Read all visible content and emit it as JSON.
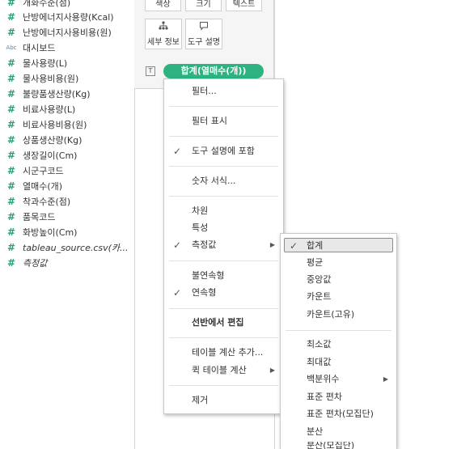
{
  "fields": [
    {
      "icon": "#",
      "label": "개화수준(점)",
      "type": "measure"
    },
    {
      "icon": "#",
      "label": "난방에너지사용량(Kcal)",
      "type": "measure"
    },
    {
      "icon": "#",
      "label": "난방에너지사용비용(원)",
      "type": "measure"
    },
    {
      "icon": "Abc",
      "label": "대시보드",
      "type": "dimension"
    },
    {
      "icon": "#",
      "label": "물사용량(L)",
      "type": "measure"
    },
    {
      "icon": "#",
      "label": "물사용비용(원)",
      "type": "measure"
    },
    {
      "icon": "#",
      "label": "불량품생산량(Kg)",
      "type": "measure"
    },
    {
      "icon": "#",
      "label": "비료사용량(L)",
      "type": "measure"
    },
    {
      "icon": "#",
      "label": "비료사용비용(원)",
      "type": "measure"
    },
    {
      "icon": "#",
      "label": "상품생산량(Kg)",
      "type": "measure"
    },
    {
      "icon": "#",
      "label": "생장길이(Cm)",
      "type": "measure"
    },
    {
      "icon": "#",
      "label": "시군구코드",
      "type": "measure"
    },
    {
      "icon": "#",
      "label": "열매수(개)",
      "type": "measure"
    },
    {
      "icon": "#",
      "label": "착과수준(점)",
      "type": "measure"
    },
    {
      "icon": "#",
      "label": "품목코드",
      "type": "measure"
    },
    {
      "icon": "#",
      "label": "화방높이(Cm)",
      "type": "measure"
    },
    {
      "icon": "#",
      "label": "tableau_source.csv(카...",
      "type": "measure",
      "italic": true
    },
    {
      "icon": "#",
      "label": "측정값",
      "type": "measure",
      "italic": true
    }
  ],
  "marks": {
    "top_buttons": [
      "색상",
      "크기",
      "텍스트"
    ],
    "detail_label": "세부 정보",
    "tooltip_label": "도구 설명",
    "text_icon": "T",
    "pill_label": "합계(열매수(개))"
  },
  "context_menu": {
    "items": [
      {
        "label": "필터...",
        "checked": false,
        "submenu": false,
        "bold": false
      },
      {
        "label": "필터 표시",
        "checked": false,
        "submenu": false,
        "bold": false
      },
      {
        "label": "도구 설명에 포함",
        "checked": true,
        "submenu": false,
        "bold": false
      },
      {
        "label": "숫자 서식...",
        "checked": false,
        "submenu": false,
        "bold": false
      },
      {
        "label": "차원",
        "checked": false,
        "submenu": false,
        "bold": false
      },
      {
        "label": "특성",
        "checked": false,
        "submenu": false,
        "bold": false
      },
      {
        "label": "측정값",
        "checked": true,
        "submenu": true,
        "bold": false
      },
      {
        "label": "불연속형",
        "checked": false,
        "submenu": false,
        "bold": false
      },
      {
        "label": "연속형",
        "checked": true,
        "submenu": false,
        "bold": false
      },
      {
        "label": "선반에서 편집",
        "checked": false,
        "submenu": false,
        "bold": true
      },
      {
        "label": "테이블 계산 추가...",
        "checked": false,
        "submenu": false,
        "bold": false
      },
      {
        "label": "퀵 테이블 계산",
        "checked": false,
        "submenu": true,
        "bold": false
      },
      {
        "label": "제거",
        "checked": false,
        "submenu": false,
        "bold": false
      }
    ]
  },
  "measure_submenu": {
    "items": [
      {
        "label": "합계",
        "checked": true,
        "selected": true,
        "submenu": false
      },
      {
        "label": "평균",
        "checked": false,
        "submenu": false
      },
      {
        "label": "중앙값",
        "checked": false,
        "submenu": false
      },
      {
        "label": "카운트",
        "checked": false,
        "submenu": false
      },
      {
        "label": "카운트(고유)",
        "checked": false,
        "submenu": false
      },
      {
        "label": "최소값",
        "checked": false,
        "submenu": false
      },
      {
        "label": "최대값",
        "checked": false,
        "submenu": false
      },
      {
        "label": "백분위수",
        "checked": false,
        "submenu": true
      },
      {
        "label": "표준 편차",
        "checked": false,
        "submenu": false
      },
      {
        "label": "표준 편차(모집단)",
        "checked": false,
        "submenu": false
      },
      {
        "label": "분산",
        "checked": false,
        "submenu": false
      },
      {
        "label": "분산(모집단)",
        "checked": false,
        "submenu": false
      }
    ]
  },
  "symbols": {
    "check": "✓",
    "submenu_arrow": "▶"
  },
  "colors": {
    "pill": "#2db37f",
    "measure_icon": "#2e9d7b",
    "dimension_icon": "#4a8bc2"
  }
}
